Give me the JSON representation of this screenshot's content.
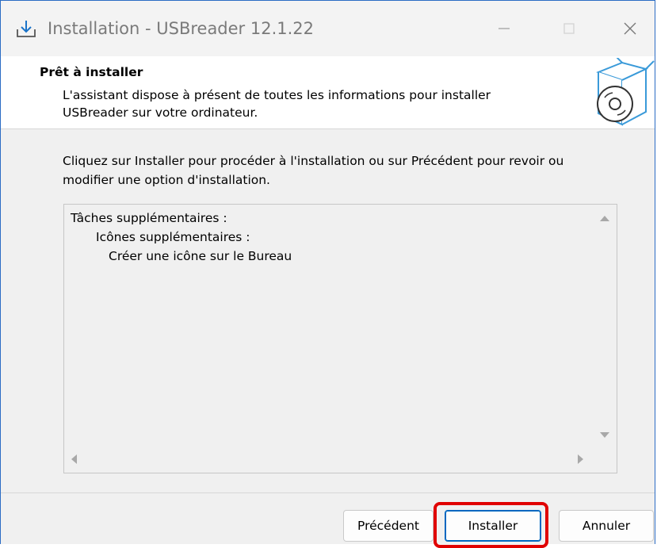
{
  "window": {
    "title": "Installation - USBreader 12.1.22"
  },
  "header": {
    "title": "Prêt à installer",
    "description": "L'assistant dispose à présent de toutes les informations pour installer USBreader sur votre ordinateur."
  },
  "main": {
    "intro": "Cliquez sur Installer pour procéder à l'installation ou sur Précédent pour revoir ou modifier une option d'installation.",
    "memo_lines": [
      "Tâches supplémentaires :",
      "Icônes supplémentaires :",
      "Créer une icône sur le Bureau"
    ]
  },
  "buttons": {
    "previous": "Précédent",
    "install": "Installer",
    "cancel": "Annuler"
  },
  "colors": {
    "accent": "#0067c0",
    "highlight": "#e00000",
    "window_border": "#2b6cc4"
  },
  "icons": {
    "app": "download-icon",
    "header_art": "box-with-disc-icon"
  }
}
